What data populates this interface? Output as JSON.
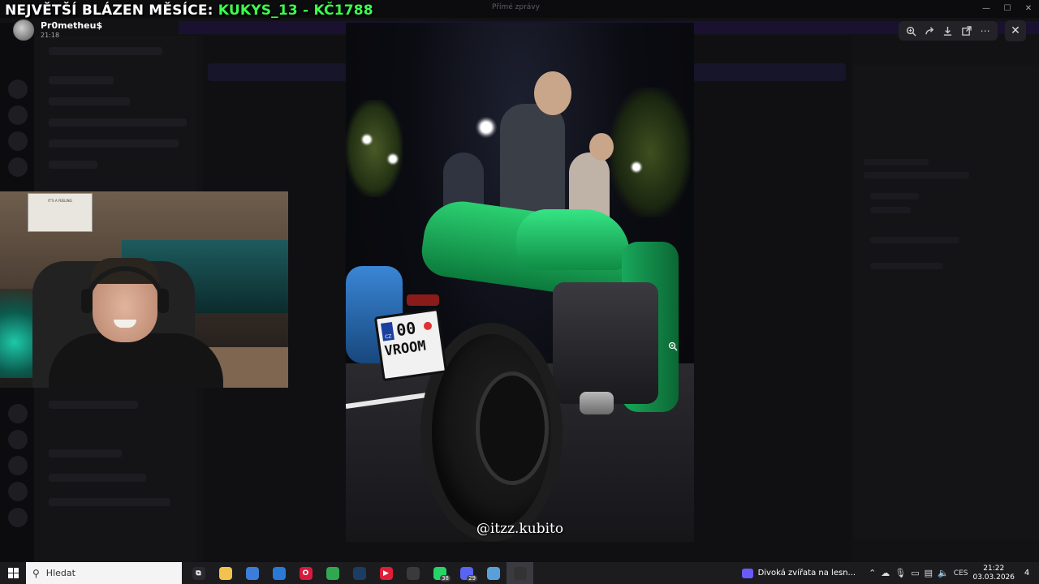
{
  "overlay": {
    "title_prefix": "NEJVĚTŠÍ BLÁZEN MĚSÍCE: ",
    "title_highlight": "KUKYS_13 - KČ1788"
  },
  "window": {
    "title": "Přímé zprávy"
  },
  "viewer": {
    "user_name": "Pr0metheu$",
    "timestamp": "21:18",
    "toolbar": [
      "zoom-in-icon",
      "forward-icon",
      "download-icon",
      "open-external-icon",
      "more-icon"
    ],
    "close_label": "✕"
  },
  "webcam": {
    "poster_text": "IT'S A FEELING"
  },
  "media": {
    "plate_country": "CZ",
    "plate_line1": "00",
    "plate_line2": "VROOM",
    "watermark": "@itzz.kubito"
  },
  "taskbar": {
    "search_placeholder": "Hledat",
    "apps": [
      {
        "name": "task-view-icon",
        "label": "⧉",
        "color": "#2a2a2e"
      },
      {
        "name": "file-explorer-icon",
        "label": "",
        "color": "#f2c14e"
      },
      {
        "name": "store-icon",
        "label": "",
        "color": "#3b7dd8"
      },
      {
        "name": "mail-icon",
        "label": "",
        "color": "#2b79d6"
      },
      {
        "name": "opera-icon",
        "label": "O",
        "color": "#d61b3c"
      },
      {
        "name": "chrome-icon",
        "label": "",
        "color": "#2fa84f"
      },
      {
        "name": "steam-icon",
        "label": "",
        "color": "#1b3c63"
      },
      {
        "name": "youtube-icon",
        "label": "▶",
        "color": "#e01e37"
      },
      {
        "name": "obs-icon",
        "label": "",
        "color": "#3a3a3a"
      },
      {
        "name": "whatsapp-icon",
        "label": "",
        "color": "#25d366",
        "badge": "38"
      },
      {
        "name": "discord-icon",
        "label": "",
        "color": "#5865f2",
        "badge": "29"
      },
      {
        "name": "app-icon",
        "label": "",
        "color": "#5aa0d8"
      },
      {
        "name": "streaming-app-icon",
        "label": "",
        "color": "#333",
        "active": true
      }
    ],
    "news": "Divoká zvířata na lesn...",
    "language": "CES",
    "time": "21:22",
    "date": "03.03.2026",
    "notification_count": "4"
  }
}
